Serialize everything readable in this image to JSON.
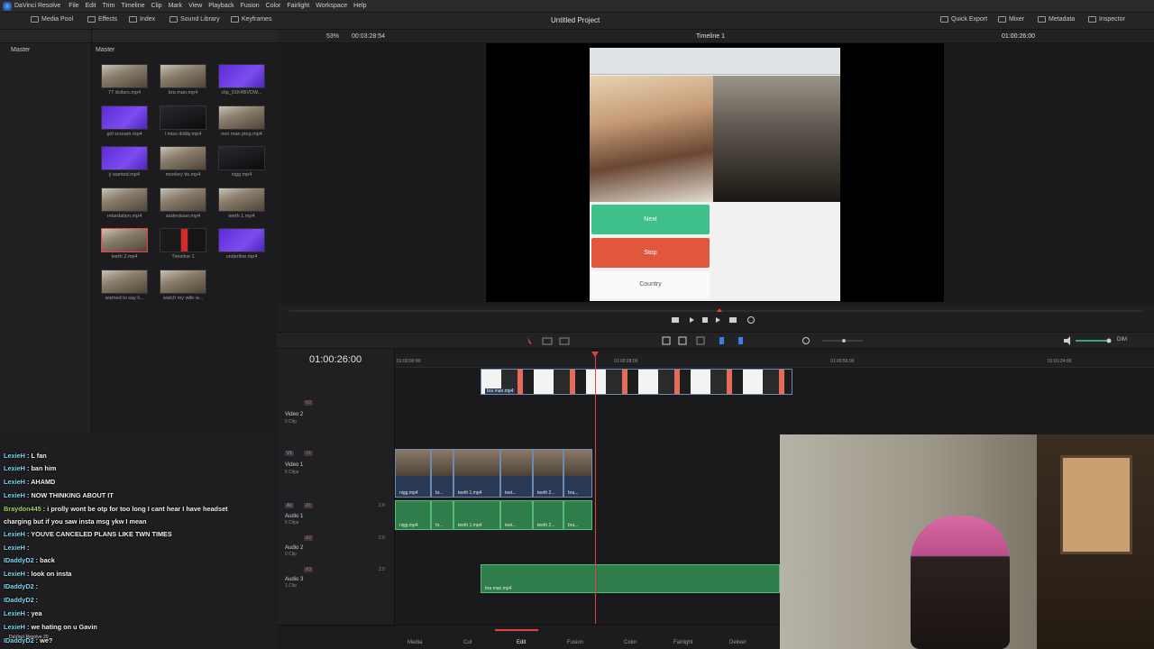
{
  "menubar": {
    "app_name": "DaVinci Resolve",
    "items": [
      "File",
      "Edit",
      "Trim",
      "Timeline",
      "Clip",
      "Mark",
      "View",
      "Playback",
      "Fusion",
      "Color",
      "Fairlight",
      "Workspace",
      "Help"
    ]
  },
  "toolbar": {
    "left": [
      "Media Pool",
      "Effects",
      "Index",
      "Sound Library",
      "Keyframes"
    ],
    "project_title": "Untitled Project",
    "right": [
      "Quick Export",
      "Mixer",
      "Metadata",
      "Inspector"
    ]
  },
  "bin": {
    "label": "Master"
  },
  "media_pool": {
    "label": "Master",
    "clips": [
      {
        "name": "77 dollars.mp4",
        "thumb": "room"
      },
      {
        "name": "bra man.mp4",
        "thumb": "room"
      },
      {
        "name": "clip_01K4BVDW...",
        "thumb": "purple"
      },
      {
        "name": "girl scream.mp4",
        "thumb": "purple"
      },
      {
        "name": "i miss diddy.mp4",
        "thumb": "dark"
      },
      {
        "name": "iron man ping.mp4",
        "thumb": "room"
      },
      {
        "name": "ji wanted.mp4",
        "thumb": "purple"
      },
      {
        "name": "monkey tts.mp4",
        "thumb": "room"
      },
      {
        "name": "nigg.mp4",
        "thumb": "dark"
      },
      {
        "name": "retardation.mp4",
        "thumb": "room"
      },
      {
        "name": "sadevisian.mp4",
        "thumb": "room"
      },
      {
        "name": "teeth 1.mp4",
        "thumb": "room"
      },
      {
        "name": "teeth 2.mp4",
        "thumb": "room",
        "selected": true
      },
      {
        "name": "Timeline 1",
        "thumb": "red"
      },
      {
        "name": "underline.mp4",
        "thumb": "purple"
      },
      {
        "name": "warned to say li...",
        "thumb": "room"
      },
      {
        "name": "watch my wife w...",
        "thumb": "room"
      }
    ]
  },
  "viewer": {
    "zoom": "53%",
    "duration": "00:03:28:54",
    "timeline_name": "Timeline 1",
    "timecode": "01:00:26:00",
    "overlay_buttons": {
      "next": "Next",
      "stop": "Stop",
      "country": "Country"
    }
  },
  "timeline": {
    "timecode": "01:00:26:00",
    "ruler": [
      "01:00:00:00",
      "01:00:28:00",
      "01:00:56:00",
      "01:01:24:00"
    ],
    "dim": "DIM",
    "tracks": [
      {
        "id": "V2",
        "name": "Video 2",
        "sub": "0 Clip"
      },
      {
        "id": "V1",
        "name": "Video 1",
        "sub": "6 Clips"
      },
      {
        "id": "A1",
        "name": "Audio 1",
        "sub": "6 Clips",
        "level": "2.0"
      },
      {
        "id": "A2",
        "name": "Audio 2",
        "sub": "0 Clip",
        "level": "2.0"
      },
      {
        "id": "A3",
        "name": "Audio 3",
        "sub": "1 Clip",
        "level": "2.0"
      }
    ],
    "clips": {
      "v3_name": "bra man.mp4",
      "v1": [
        "nigg.mp4",
        "br...",
        "teeth 1.mp4",
        "teet...",
        "teeth 2...",
        "bra..."
      ],
      "a1": [
        "nigg.mp4",
        "br...",
        "teeth 1.mp4",
        "teet...",
        "teeth 2...",
        "bra..."
      ],
      "a3_name": "bra man.mp4"
    }
  },
  "pages": [
    "Media",
    "Cut",
    "Edit",
    "Fusion",
    "Color",
    "Fairlight",
    "Deliver"
  ],
  "active_page": "Edit",
  "stream_chat": [
    {
      "user": "LexieH",
      "text": "L fan"
    },
    {
      "user": "LexieH",
      "text": "ban him"
    },
    {
      "user": "LexieH",
      "text": "AHAMD"
    },
    {
      "user": "LexieH",
      "text": "NOW THINKING ABOUT IT"
    },
    {
      "user": "Braydon445",
      "text": "i prolly wont be otp for too long I cant hear I have headset"
    },
    {
      "user": "",
      "text": "charging but if you saw insta msg ykw I mean"
    },
    {
      "user": "LexieH",
      "text": "YOUVE CANCELED PLANS LIKE TWN TIMES"
    },
    {
      "user": "LexieH",
      "text": ""
    },
    {
      "user": "IDaddyD2",
      "text": "back"
    },
    {
      "user": "LexieH",
      "text": "look on insta"
    },
    {
      "user": "IDaddyD2",
      "text": ""
    },
    {
      "user": "IDaddyD2",
      "text": ""
    },
    {
      "user": "LexieH",
      "text": "yea"
    },
    {
      "user": "LexieH",
      "text": "we hating on u Gavin"
    },
    {
      "user": "IDaddyD2",
      "text": "we?"
    }
  ],
  "footer_brand": "DaVinci Resolve 20"
}
